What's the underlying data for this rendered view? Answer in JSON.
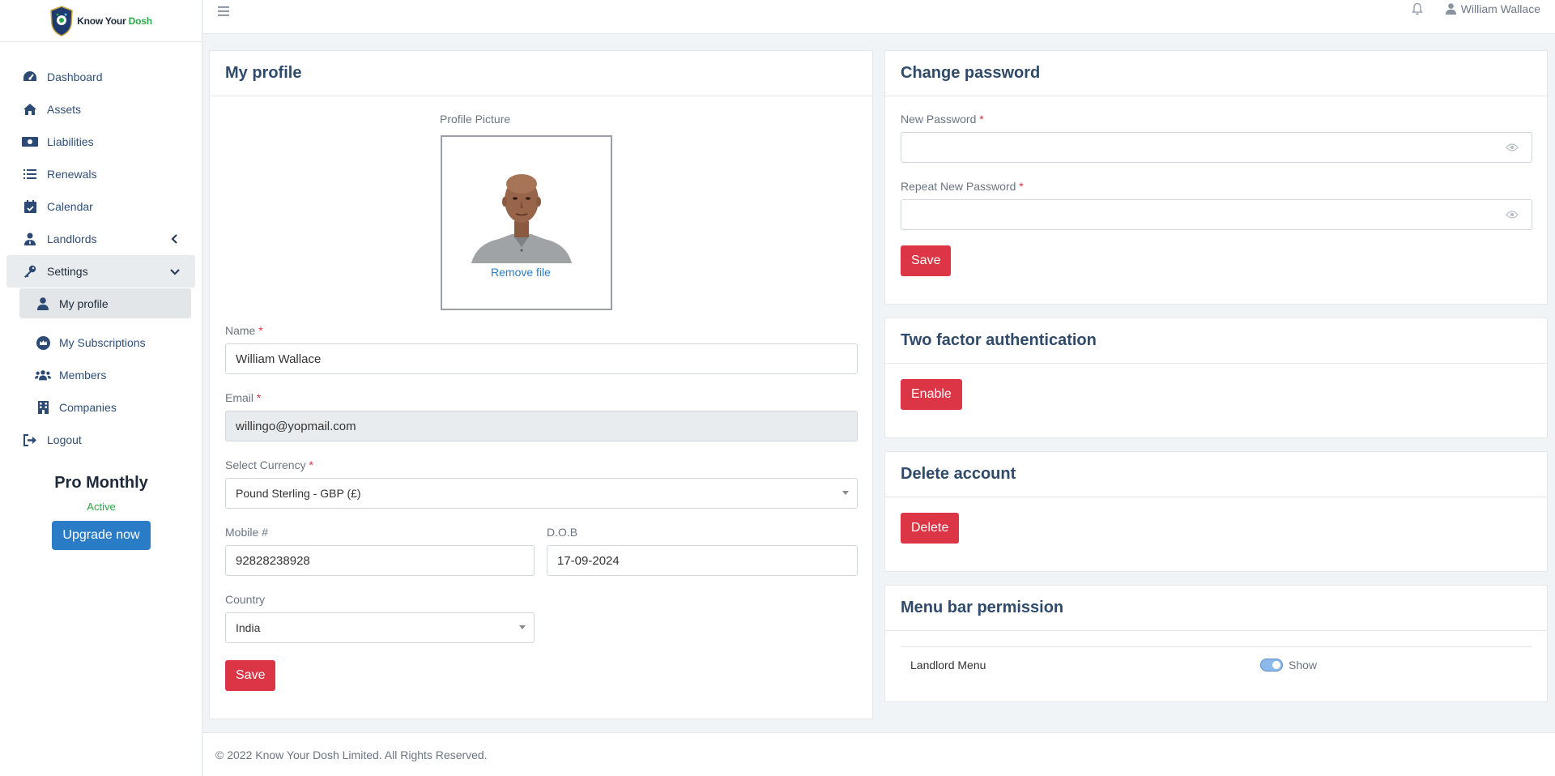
{
  "brand": {
    "name_part1": "Know Your ",
    "name_part2": "Dosh"
  },
  "sidebar": {
    "items": [
      {
        "label": "Dashboard",
        "icon": "dashboard-icon"
      },
      {
        "label": "Assets",
        "icon": "home-icon"
      },
      {
        "label": "Liabilities",
        "icon": "money-icon"
      },
      {
        "label": "Renewals",
        "icon": "list-icon"
      },
      {
        "label": "Calendar",
        "icon": "calendar-check-icon"
      },
      {
        "label": "Landlords",
        "icon": "user-tie-icon"
      },
      {
        "label": "Settings",
        "icon": "key-icon"
      }
    ],
    "sub_items": [
      {
        "label": "My profile",
        "icon": "user-icon"
      },
      {
        "label": "My Subscriptions",
        "icon": "crown-icon"
      },
      {
        "label": "Members",
        "icon": "users-icon"
      },
      {
        "label": "Companies",
        "icon": "building-icon"
      }
    ],
    "logout": {
      "label": "Logout",
      "icon": "sign-out-icon"
    },
    "plan": {
      "name": "Pro Monthly",
      "status": "Active",
      "upgrade_label": "Upgrade now"
    }
  },
  "topbar": {
    "user_name": "William Wallace"
  },
  "profile": {
    "title": "My profile",
    "picture_label": "Profile Picture",
    "remove_file": "Remove file",
    "name_label": "Name",
    "name_value": "William Wallace",
    "email_label": "Email",
    "email_value": "willingo@yopmail.com",
    "currency_label": "Select Currency",
    "currency_value": "Pound Sterling - GBP (£)",
    "mobile_label": "Mobile #",
    "mobile_value": "92828238928",
    "dob_label": "D.O.B",
    "dob_value": "17-09-2024",
    "country_label": "Country",
    "country_value": "India",
    "save_label": "Save",
    "required_mark": "*"
  },
  "change_password": {
    "title": "Change password",
    "new_label": "New Password",
    "repeat_label": "Repeat New Password",
    "save_label": "Save"
  },
  "two_factor": {
    "title": "Two factor authentication",
    "enable_label": "Enable"
  },
  "delete_account": {
    "title": "Delete account",
    "delete_label": "Delete"
  },
  "menu_permission": {
    "title": "Menu bar permission",
    "row_label": "Landlord Menu",
    "toggle_label": "Show",
    "toggle_on": true
  },
  "footer": {
    "text": "© 2022 Know Your Dosh Limited. All Rights Reserved."
  },
  "colors": {
    "primary": "#2a7cc7",
    "danger": "#dc3545",
    "success": "#28a745",
    "heading": "#2f4a6a"
  }
}
